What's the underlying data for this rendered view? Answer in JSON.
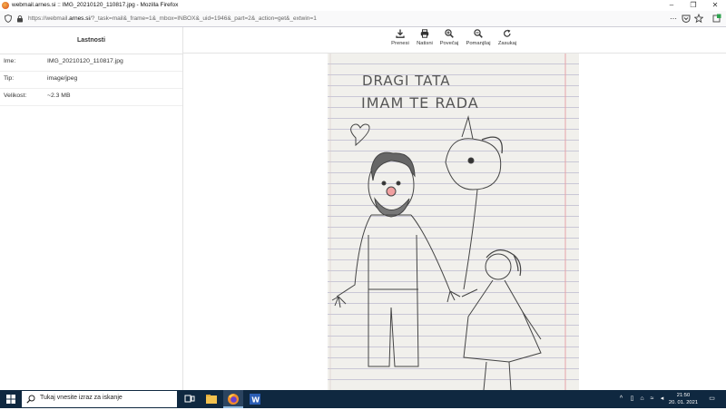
{
  "window": {
    "title": "webmail.arnes.si :: IMG_20210120_110817.jpg - Mozilla Firefox",
    "minimize": "–",
    "maximize": "❐",
    "close": "✕"
  },
  "url": {
    "prefix": "https://webmail.",
    "domain": "arnes.si",
    "rest": "/?_task=mail&_frame=1&_mbox=INBOX&_uid=1946&_part=2&_action=get&_extwin=1",
    "more": "⋯"
  },
  "sidebar": {
    "header": "Lastnosti",
    "rows": [
      {
        "label": "Ime:",
        "value": "IMG_20210120_110817.jpg"
      },
      {
        "label": "Tip:",
        "value": "image/jpeg"
      },
      {
        "label": "Velikost:",
        "value": "~2.3 MB"
      }
    ]
  },
  "toolbar": {
    "download": "Prenesi",
    "print": "Natisni",
    "zoom_in": "Povečaj",
    "zoom_out": "Pomanjšaj",
    "rotate": "Zasukaj"
  },
  "drawing": {
    "line1": "DRAGI TATA",
    "line2": "IMAM TE RADA"
  },
  "taskbar": {
    "search_placeholder": "Tukaj vnesite izraz za iskanje",
    "time": "21:50",
    "date": "20. 01. 2021"
  },
  "colors": {
    "accent": "#0060df",
    "taskbar": "#0f2840",
    "paper": "#f1f0ec"
  }
}
